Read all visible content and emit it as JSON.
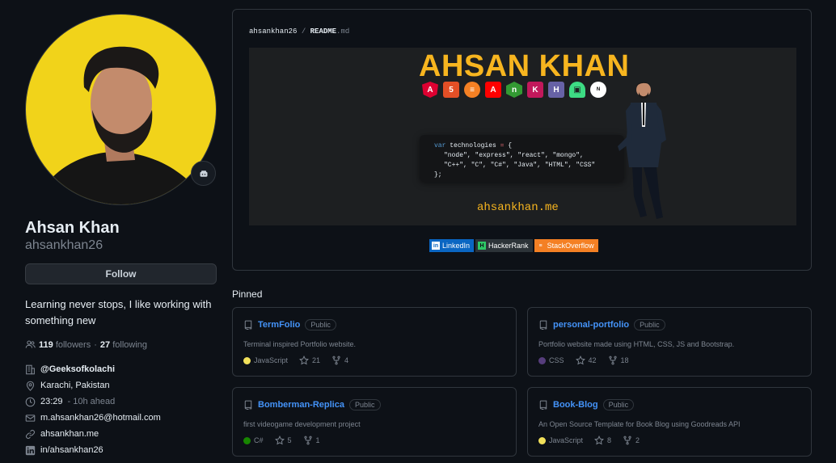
{
  "profile": {
    "name": "Ahsan Khan",
    "login": "ahsankhan26",
    "follow_label": "Follow",
    "bio": "Learning never stops, I like working with something new",
    "followers_count": "119",
    "followers_label": "followers",
    "separator": "·",
    "following_count": "27",
    "following_label": "following",
    "org": "@Geeksofkolachi",
    "location": "Karachi, Pakistan",
    "time": "23:29",
    "time_note": "- 10h ahead",
    "email": "m.ahsankhan26@hotmail.com",
    "website": "ahsankhan.me",
    "linkedin": "in/ahsankhan26"
  },
  "readme": {
    "owner": "ahsankhan26",
    "slash": "/",
    "file": "README",
    "ext": ".md",
    "banner": {
      "title": "AHSAN KHAN",
      "site": "ahsankhan.me",
      "code_line1_kw": "var",
      "code_line1_name": "technologies",
      "code_line1_eq": "=",
      "code_line1_brace": "{",
      "code_line2": "\"node\", \"express\", \"react\", \"mongo\",",
      "code_line3": "\"C++\", \"C\", \"C#\", \"Java\", \"HTML\", \"CSS\"",
      "code_line4": "};",
      "tech_icons": [
        "angular-icon",
        "html5-icon",
        "stackoverflow-icon",
        "adobe-icon",
        "nodejs-icon",
        "kotlin-icon",
        "heroku-icon",
        "android-icon",
        "nextjs-icon"
      ]
    },
    "badges": [
      {
        "label": "LinkedIn",
        "color": "#0a66c2",
        "icon": "in"
      },
      {
        "label": "HackerRank",
        "color": "#2c3338",
        "icon": "H"
      },
      {
        "label": "StackOverflow",
        "color": "#f48024",
        "icon": "≡"
      }
    ]
  },
  "pinned": {
    "title": "Pinned",
    "public_label": "Public",
    "repos": [
      {
        "name": "TermFolio",
        "desc": "Terminal inspired Portfolio website.",
        "lang": "JavaScript",
        "lang_color": "#f1e05a",
        "stars": "21",
        "forks": "4"
      },
      {
        "name": "personal-portfolio",
        "desc": "Portfolio website made using HTML, CSS, JS and Bootstrap.",
        "lang": "CSS",
        "lang_color": "#563d7c",
        "stars": "42",
        "forks": "18"
      },
      {
        "name": "Bomberman-Replica",
        "desc": "first videogame development project",
        "lang": "C#",
        "lang_color": "#178600",
        "stars": "5",
        "forks": "1"
      },
      {
        "name": "Book-Blog",
        "desc": "An Open Source Template for Book Blog using Goodreads API",
        "lang": "JavaScript",
        "lang_color": "#f1e05a",
        "stars": "8",
        "forks": "2"
      }
    ]
  }
}
